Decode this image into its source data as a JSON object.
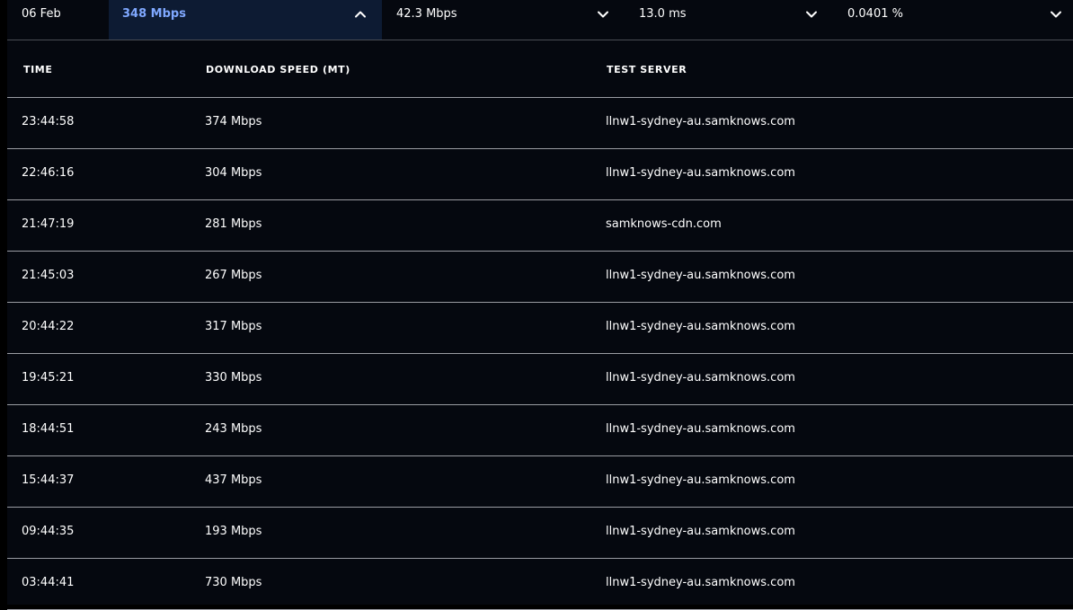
{
  "summary": {
    "date": "06 Feb",
    "download": "348 Mbps",
    "upload": "42.3 Mbps",
    "latency": "13.0 ms",
    "packet_loss": "0.0401 %",
    "download_expanded": true
  },
  "table": {
    "headers": {
      "time": "TIME",
      "download_speed": "DOWNLOAD SPEED (MT)",
      "test_server": "TEST SERVER"
    },
    "rows": [
      {
        "time": "23:44:58",
        "speed": "374 Mbps",
        "server": "llnw1-sydney-au.samknows.com"
      },
      {
        "time": "22:46:16",
        "speed": "304 Mbps",
        "server": "llnw1-sydney-au.samknows.com"
      },
      {
        "time": "21:47:19",
        "speed": "281 Mbps",
        "server": "samknows-cdn.com"
      },
      {
        "time": "21:45:03",
        "speed": "267 Mbps",
        "server": "llnw1-sydney-au.samknows.com"
      },
      {
        "time": "20:44:22",
        "speed": "317 Mbps",
        "server": "llnw1-sydney-au.samknows.com"
      },
      {
        "time": "19:45:21",
        "speed": "330 Mbps",
        "server": "llnw1-sydney-au.samknows.com"
      },
      {
        "time": "18:44:51",
        "speed": "243 Mbps",
        "server": "llnw1-sydney-au.samknows.com"
      },
      {
        "time": "15:44:37",
        "speed": "437 Mbps",
        "server": "llnw1-sydney-au.samknows.com"
      },
      {
        "time": "09:44:35",
        "speed": "193 Mbps",
        "server": "llnw1-sydney-au.samknows.com"
      },
      {
        "time": "03:44:41",
        "speed": "730 Mbps",
        "server": "llnw1-sydney-au.samknows.com"
      }
    ]
  },
  "icons": {
    "expanded": "chevron-up-icon",
    "collapsed": "chevron-down-icon"
  },
  "colors": {
    "background": "#05080f",
    "highlight_bg": "#0d1b33",
    "highlight_text": "#7fa8ff",
    "divider": "#9a9ca2"
  }
}
